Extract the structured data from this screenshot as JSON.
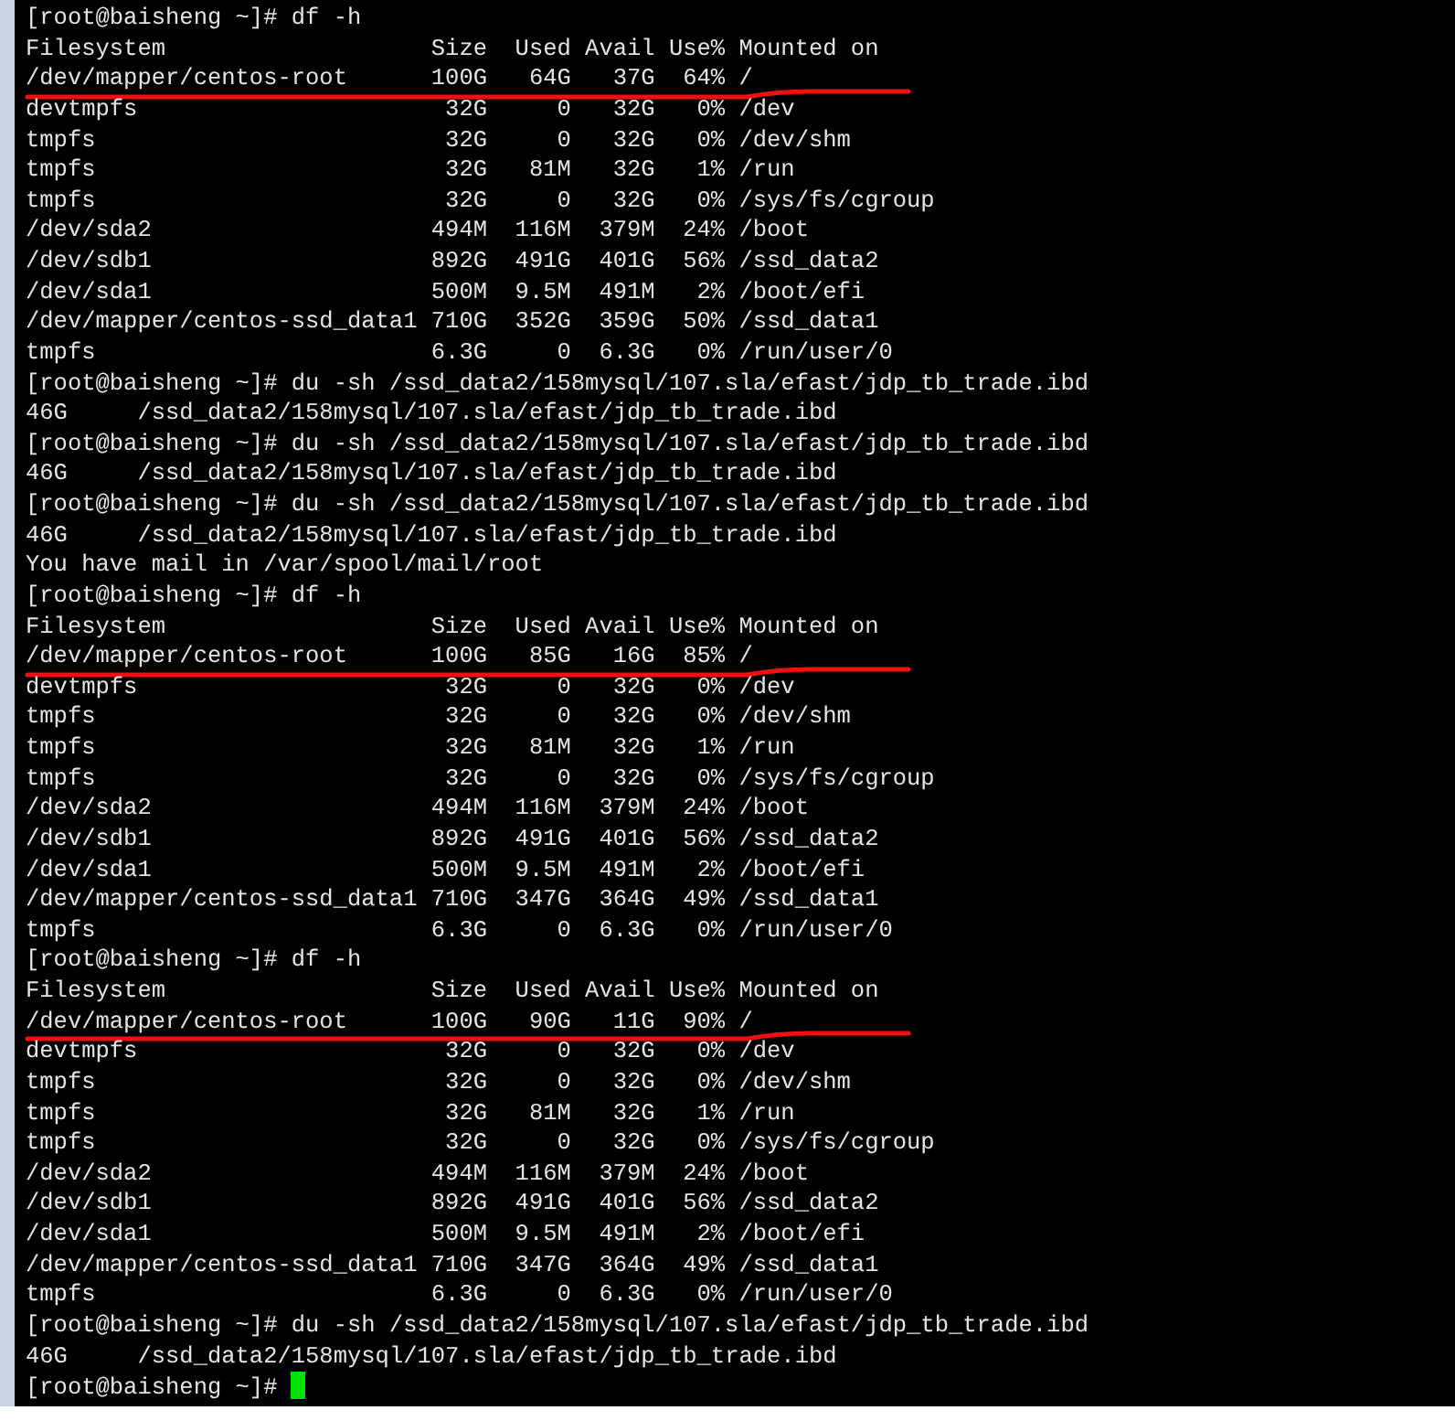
{
  "terminal": {
    "lines": [
      {
        "kind": "prompt",
        "text": "[root@baisheng ~]# df -h"
      },
      {
        "kind": "table",
        "cells": [
          "Filesystem",
          "Size",
          "Used",
          "Avail",
          "Use%",
          "Mounted on"
        ]
      },
      {
        "kind": "table",
        "cells": [
          "/dev/mapper/centos-root",
          "100G",
          "64G",
          "37G",
          "64%",
          "/"
        ],
        "underlined": true
      },
      {
        "kind": "table",
        "cells": [
          "devtmpfs",
          "32G",
          "0",
          "32G",
          "0%",
          "/dev"
        ]
      },
      {
        "kind": "table",
        "cells": [
          "tmpfs",
          "32G",
          "0",
          "32G",
          "0%",
          "/dev/shm"
        ]
      },
      {
        "kind": "table",
        "cells": [
          "tmpfs",
          "32G",
          "81M",
          "32G",
          "1%",
          "/run"
        ]
      },
      {
        "kind": "table",
        "cells": [
          "tmpfs",
          "32G",
          "0",
          "32G",
          "0%",
          "/sys/fs/cgroup"
        ]
      },
      {
        "kind": "table",
        "cells": [
          "/dev/sda2",
          "494M",
          "116M",
          "379M",
          "24%",
          "/boot"
        ]
      },
      {
        "kind": "table",
        "cells": [
          "/dev/sdb1",
          "892G",
          "491G",
          "401G",
          "56%",
          "/ssd_data2"
        ]
      },
      {
        "kind": "table",
        "cells": [
          "/dev/sda1",
          "500M",
          "9.5M",
          "491M",
          "2%",
          "/boot/efi"
        ]
      },
      {
        "kind": "table",
        "cells": [
          "/dev/mapper/centos-ssd_data1",
          "710G",
          "352G",
          "359G",
          "50%",
          "/ssd_data1"
        ]
      },
      {
        "kind": "table",
        "cells": [
          "tmpfs",
          "6.3G",
          "0",
          "6.3G",
          "0%",
          "/run/user/0"
        ]
      },
      {
        "kind": "prompt",
        "text": "[root@baisheng ~]# du -sh /ssd_data2/158mysql/107.sla/efast/jdp_tb_trade.ibd"
      },
      {
        "kind": "output",
        "text": "46G\t/ssd_data2/158mysql/107.sla/efast/jdp_tb_trade.ibd"
      },
      {
        "kind": "prompt",
        "text": "[root@baisheng ~]# du -sh /ssd_data2/158mysql/107.sla/efast/jdp_tb_trade.ibd"
      },
      {
        "kind": "output",
        "text": "46G\t/ssd_data2/158mysql/107.sla/efast/jdp_tb_trade.ibd"
      },
      {
        "kind": "prompt",
        "text": "[root@baisheng ~]# du -sh /ssd_data2/158mysql/107.sla/efast/jdp_tb_trade.ibd"
      },
      {
        "kind": "output",
        "text": "46G\t/ssd_data2/158mysql/107.sla/efast/jdp_tb_trade.ibd"
      },
      {
        "kind": "output",
        "text": "You have mail in /var/spool/mail/root"
      },
      {
        "kind": "prompt",
        "text": "[root@baisheng ~]# df -h"
      },
      {
        "kind": "table",
        "cells": [
          "Filesystem",
          "Size",
          "Used",
          "Avail",
          "Use%",
          "Mounted on"
        ]
      },
      {
        "kind": "table",
        "cells": [
          "/dev/mapper/centos-root",
          "100G",
          "85G",
          "16G",
          "85%",
          "/"
        ],
        "underlined": true
      },
      {
        "kind": "table",
        "cells": [
          "devtmpfs",
          "32G",
          "0",
          "32G",
          "0%",
          "/dev"
        ]
      },
      {
        "kind": "table",
        "cells": [
          "tmpfs",
          "32G",
          "0",
          "32G",
          "0%",
          "/dev/shm"
        ]
      },
      {
        "kind": "table",
        "cells": [
          "tmpfs",
          "32G",
          "81M",
          "32G",
          "1%",
          "/run"
        ]
      },
      {
        "kind": "table",
        "cells": [
          "tmpfs",
          "32G",
          "0",
          "32G",
          "0%",
          "/sys/fs/cgroup"
        ]
      },
      {
        "kind": "table",
        "cells": [
          "/dev/sda2",
          "494M",
          "116M",
          "379M",
          "24%",
          "/boot"
        ]
      },
      {
        "kind": "table",
        "cells": [
          "/dev/sdb1",
          "892G",
          "491G",
          "401G",
          "56%",
          "/ssd_data2"
        ]
      },
      {
        "kind": "table",
        "cells": [
          "/dev/sda1",
          "500M",
          "9.5M",
          "491M",
          "2%",
          "/boot/efi"
        ]
      },
      {
        "kind": "table",
        "cells": [
          "/dev/mapper/centos-ssd_data1",
          "710G",
          "347G",
          "364G",
          "49%",
          "/ssd_data1"
        ]
      },
      {
        "kind": "table",
        "cells": [
          "tmpfs",
          "6.3G",
          "0",
          "6.3G",
          "0%",
          "/run/user/0"
        ]
      },
      {
        "kind": "prompt",
        "text": "[root@baisheng ~]# df -h"
      },
      {
        "kind": "table",
        "cells": [
          "Filesystem",
          "Size",
          "Used",
          "Avail",
          "Use%",
          "Mounted on"
        ]
      },
      {
        "kind": "table",
        "cells": [
          "/dev/mapper/centos-root",
          "100G",
          "90G",
          "11G",
          "90%",
          "/"
        ],
        "underlined": true
      },
      {
        "kind": "table",
        "cells": [
          "devtmpfs",
          "32G",
          "0",
          "32G",
          "0%",
          "/dev"
        ]
      },
      {
        "kind": "table",
        "cells": [
          "tmpfs",
          "32G",
          "0",
          "32G",
          "0%",
          "/dev/shm"
        ]
      },
      {
        "kind": "table",
        "cells": [
          "tmpfs",
          "32G",
          "81M",
          "32G",
          "1%",
          "/run"
        ]
      },
      {
        "kind": "table",
        "cells": [
          "tmpfs",
          "32G",
          "0",
          "32G",
          "0%",
          "/sys/fs/cgroup"
        ]
      },
      {
        "kind": "table",
        "cells": [
          "/dev/sda2",
          "494M",
          "116M",
          "379M",
          "24%",
          "/boot"
        ]
      },
      {
        "kind": "table",
        "cells": [
          "/dev/sdb1",
          "892G",
          "491G",
          "401G",
          "56%",
          "/ssd_data2"
        ]
      },
      {
        "kind": "table",
        "cells": [
          "/dev/sda1",
          "500M",
          "9.5M",
          "491M",
          "2%",
          "/boot/efi"
        ]
      },
      {
        "kind": "table",
        "cells": [
          "/dev/mapper/centos-ssd_data1",
          "710G",
          "347G",
          "364G",
          "49%",
          "/ssd_data1"
        ]
      },
      {
        "kind": "table",
        "cells": [
          "tmpfs",
          "6.3G",
          "0",
          "6.3G",
          "0%",
          "/run/user/0"
        ]
      },
      {
        "kind": "prompt",
        "text": "[root@baisheng ~]# du -sh /ssd_data2/158mysql/107.sla/efast/jdp_tb_trade.ibd"
      },
      {
        "kind": "output",
        "text": "46G\t/ssd_data2/158mysql/107.sla/efast/jdp_tb_trade.ibd"
      },
      {
        "kind": "prompt",
        "text": "[root@baisheng ~]#",
        "cursor": true
      }
    ]
  }
}
